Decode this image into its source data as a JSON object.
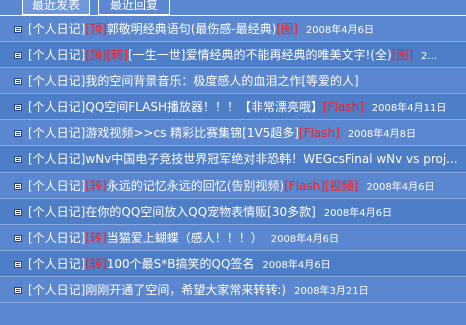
{
  "tabs": {
    "recent_posts": "最近发表",
    "recent_replies": "最近回复"
  },
  "posts": [
    {
      "category": "[个人日记]",
      "prefix": "[顶]",
      "title": "郭敬明经典语句(最伤感-最经典)",
      "suffix": "[图]",
      "date": "2008年4月6日"
    },
    {
      "category": "[个人日记]",
      "prefix": "[顶][转]",
      "title": "[一生一世]爱情经典的不能再经典的唯美文字!(全)",
      "suffix": "[图]",
      "date": "2..."
    },
    {
      "category": "[个人日记]",
      "prefix": "",
      "title": "我的空间背景音乐：极度感人的血泪之作[等爱的人]",
      "suffix": "",
      "date": ""
    },
    {
      "category": "[个人日记]",
      "prefix": "",
      "title": "QQ空间FLASH播放器！！！【非常漂亮哦】",
      "suffix": "[Flash]",
      "date": "2008年4月11日"
    },
    {
      "category": "[个人日记]",
      "prefix": "",
      "title": "游戏视频>>cs 精彩比赛集锦[1V5超多]",
      "suffix": "[Flash]",
      "date": "2008年4月8日"
    },
    {
      "category": "[个人日记]",
      "prefix": "",
      "title": "wNv中国电子竞技世界冠军绝对非恐韩！WEGcsFinal wNv vs proj...",
      "suffix": "",
      "date": ""
    },
    {
      "category": "[个人日记]",
      "prefix": "[转]",
      "title": "永远的记忆永远的回忆(告别视频)",
      "suffix": "[Flash][视频]",
      "date": "2008年4月6日"
    },
    {
      "category": "[个人日记]",
      "prefix": "",
      "title": "在你的QQ空间放入QQ宠物表情贩[30多款]",
      "suffix": "",
      "date": "2008年4月6日"
    },
    {
      "category": "[个人日记]",
      "prefix": "[转]",
      "title": "当猫爱上蝴蝶（感人！！！）",
      "suffix": "",
      "date": "2008年4月6日"
    },
    {
      "category": "[个人日记]",
      "prefix": "[转]",
      "title": "100个最S*B搞笑的QQ签名",
      "suffix": "",
      "date": "2008年4月6日"
    },
    {
      "category": "[个人日记]",
      "prefix": "",
      "title": "刚刚开通了空间，希望大家常来转转:)",
      "suffix": "",
      "date": "2008年3月21日"
    }
  ]
}
